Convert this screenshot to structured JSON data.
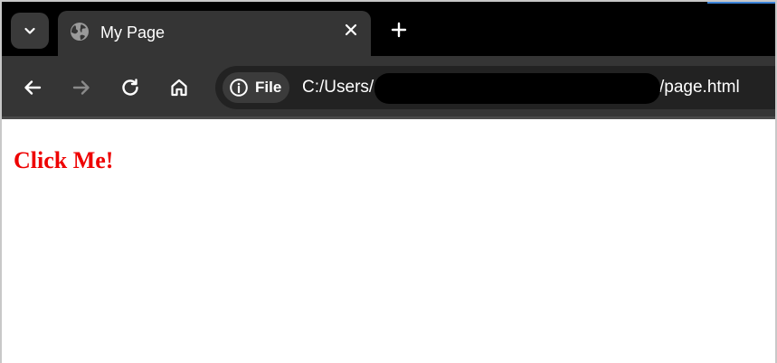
{
  "browser": {
    "tab": {
      "title": "My Page",
      "icon": "globe-icon"
    },
    "new_tab_icon": "plus-icon",
    "tab_search_icon": "chevron-down-icon",
    "close_icon": "close-icon",
    "nav": {
      "back_icon": "arrow-left-icon",
      "forward_icon": "arrow-right-icon",
      "reload_icon": "reload-icon",
      "home_icon": "home-icon"
    },
    "address_bar": {
      "site_chip_label": "File",
      "site_chip_icon": "info-icon",
      "url_prefix": "C:/Users/",
      "url_suffix": "/page.html"
    }
  },
  "page": {
    "heading": "Click Me!"
  },
  "colors": {
    "tabstrip_bg": "#000000",
    "toolbar_bg": "#353535",
    "omnibox_bg": "#222222",
    "link_red": "#ee0000"
  }
}
